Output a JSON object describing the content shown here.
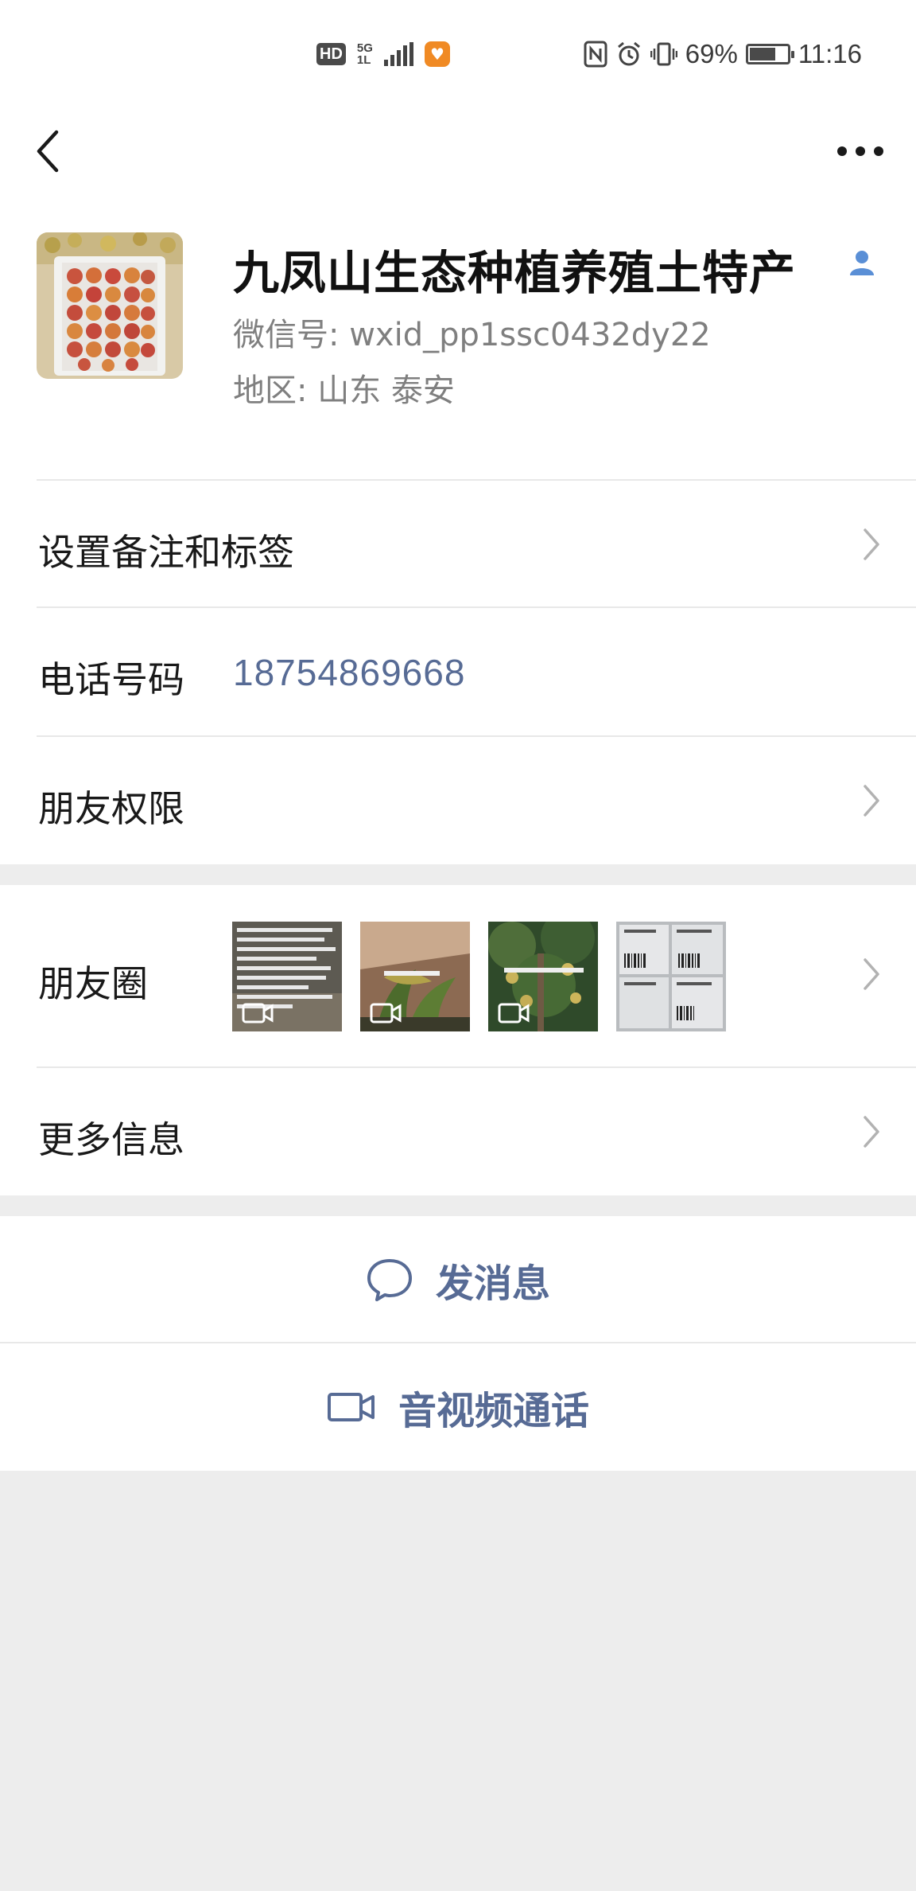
{
  "status_bar": {
    "hd": "HD",
    "network": "5G",
    "network_sub": "1L",
    "battery_pct": "69%",
    "battery_level": 0.69,
    "time": "11:16"
  },
  "nav": {
    "back_icon": "chevron-left-icon",
    "more_icon": "more-dots-icon"
  },
  "profile": {
    "name": "九凤山生态种植养殖土特产",
    "wechat_id": "微信号: wxid_pp1ssc0432dy22",
    "region": "地区: 山东  泰安"
  },
  "rows": {
    "remark_label": "设置备注和标签",
    "phone_label": "电话号码",
    "phone_value": "18754869668",
    "permission_label": "朋友权限",
    "moments_label": "朋友圈",
    "more_info_label": "更多信息"
  },
  "moments_thumbs": [
    {
      "text": "红薯苗出苗中，接受预定。品种有西瓜红、蜜薯、烟薯25(蜜薯)，哈密，紫薯，济薯26(板栗薯)，普薯32…",
      "video": true
    },
    {
      "text": "红薯苗预定中",
      "video": true
    },
    {
      "text": "早蜜桃成熟中",
      "video": true
    },
    {
      "text": "",
      "video": false
    }
  ],
  "actions": {
    "message": "发消息",
    "call": "音视频通话"
  },
  "colors": {
    "link": "#576b95",
    "bg": "#ededed"
  }
}
